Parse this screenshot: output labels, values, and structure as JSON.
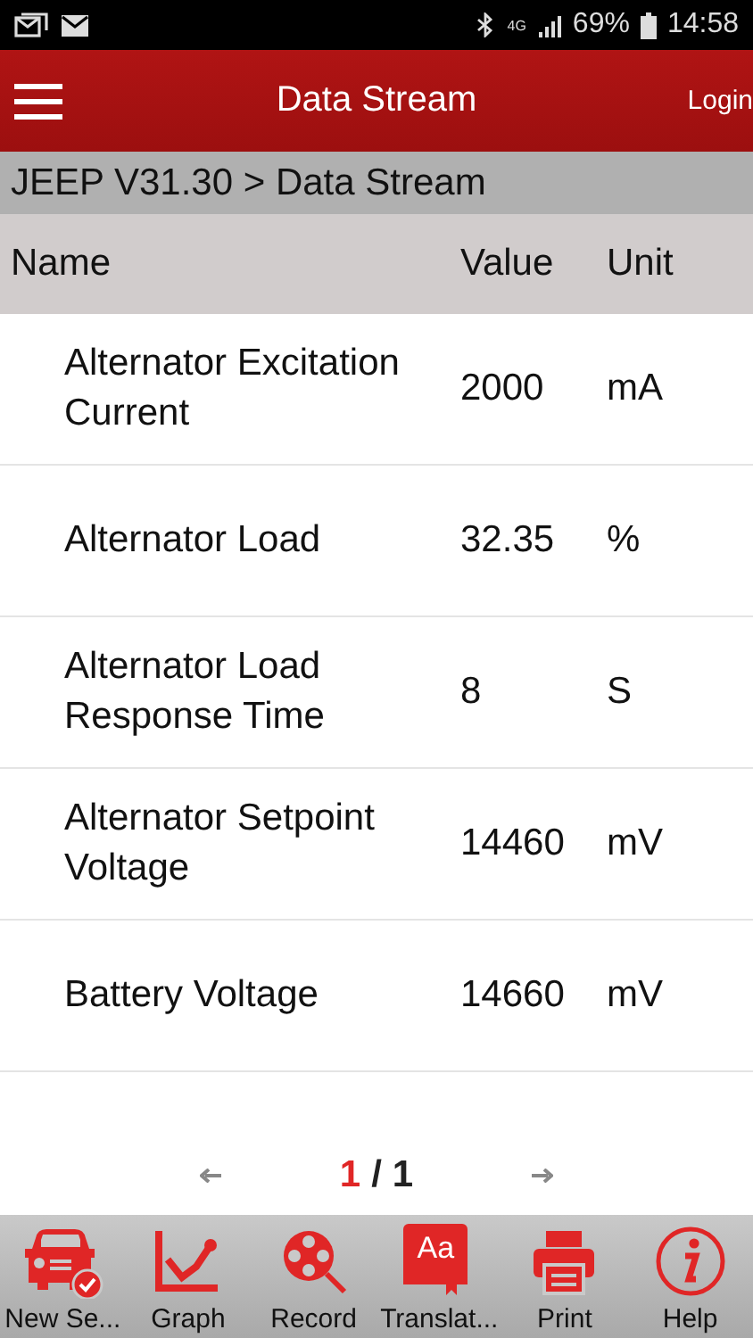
{
  "status_bar": {
    "network": "4G",
    "battery": "69%",
    "time": "14:58"
  },
  "header": {
    "title": "Data Stream",
    "login": "Login"
  },
  "breadcrumb": "JEEP V31.30 > Data Stream",
  "table": {
    "columns": [
      "Name",
      "Value",
      "Unit"
    ],
    "rows": [
      {
        "name": "Alternator Excitation Current",
        "value": "2000",
        "unit": "mA"
      },
      {
        "name": "Alternator Load",
        "value": "32.35",
        "unit": "%"
      },
      {
        "name": "Alternator Load Response Time",
        "value": "8",
        "unit": "S"
      },
      {
        "name": "Alternator Setpoint Voltage",
        "value": "14460",
        "unit": "mV"
      },
      {
        "name": "Battery Voltage",
        "value": "14660",
        "unit": "mV"
      }
    ]
  },
  "pagination": {
    "current": "1",
    "separator": "/",
    "total": "1"
  },
  "toolbar": [
    {
      "kind": "car",
      "label": "New Se..."
    },
    {
      "kind": "graph",
      "label": "Graph"
    },
    {
      "kind": "record",
      "label": "Record"
    },
    {
      "kind": "translate",
      "label": "Translat...",
      "icon_text": "Aa"
    },
    {
      "kind": "print",
      "label": "Print"
    },
    {
      "kind": "help",
      "label": "Help"
    }
  ]
}
